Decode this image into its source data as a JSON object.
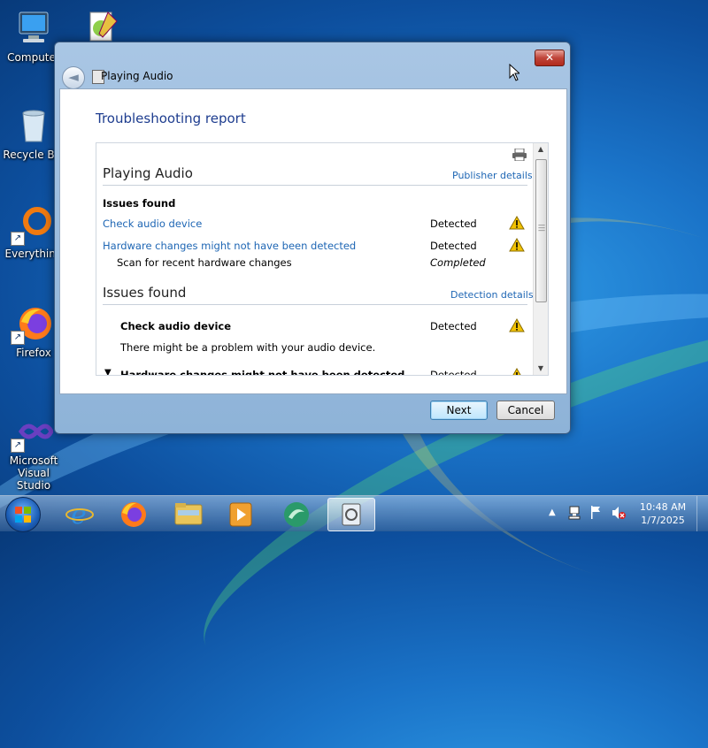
{
  "desktop": {
    "icons": [
      {
        "label": "Computer"
      },
      {
        "label": ""
      },
      {
        "label": "Recycle Bin"
      },
      {
        "label": "Everything"
      },
      {
        "label": "Firefox"
      },
      {
        "label": "Microsoft Visual Studio"
      }
    ]
  },
  "dialog": {
    "title": "Playing Audio",
    "close_label": "✕",
    "heading": "Troubleshooting report",
    "section1": {
      "title": "Playing Audio",
      "link": "Publisher details",
      "issues_label": "Issues found",
      "rows": [
        {
          "label": "Check audio device",
          "status": "Detected"
        },
        {
          "label": "Hardware changes might not have been detected",
          "status": "Detected"
        },
        {
          "label": "Scan for recent hardware changes",
          "status": "Completed"
        }
      ]
    },
    "section2": {
      "title": "Issues found",
      "link": "Detection details",
      "items": [
        {
          "label": "Check audio device",
          "status": "Detected",
          "description": "There might be a problem with your audio device."
        },
        {
          "label": "Hardware changes might not have been detected",
          "status": "Detected"
        }
      ]
    },
    "buttons": {
      "next": "Next",
      "cancel": "Cancel"
    }
  },
  "taskbar": {
    "apps": [
      "internet-explorer",
      "firefox",
      "file-explorer",
      "media-player",
      "app-green",
      "troubleshooter"
    ],
    "clock": {
      "time": "10:48 AM",
      "date": "1/7/2025"
    }
  },
  "colors": {
    "link": "#1e66b4",
    "heading": "#1e3d8f",
    "warning": "#f2c200"
  }
}
